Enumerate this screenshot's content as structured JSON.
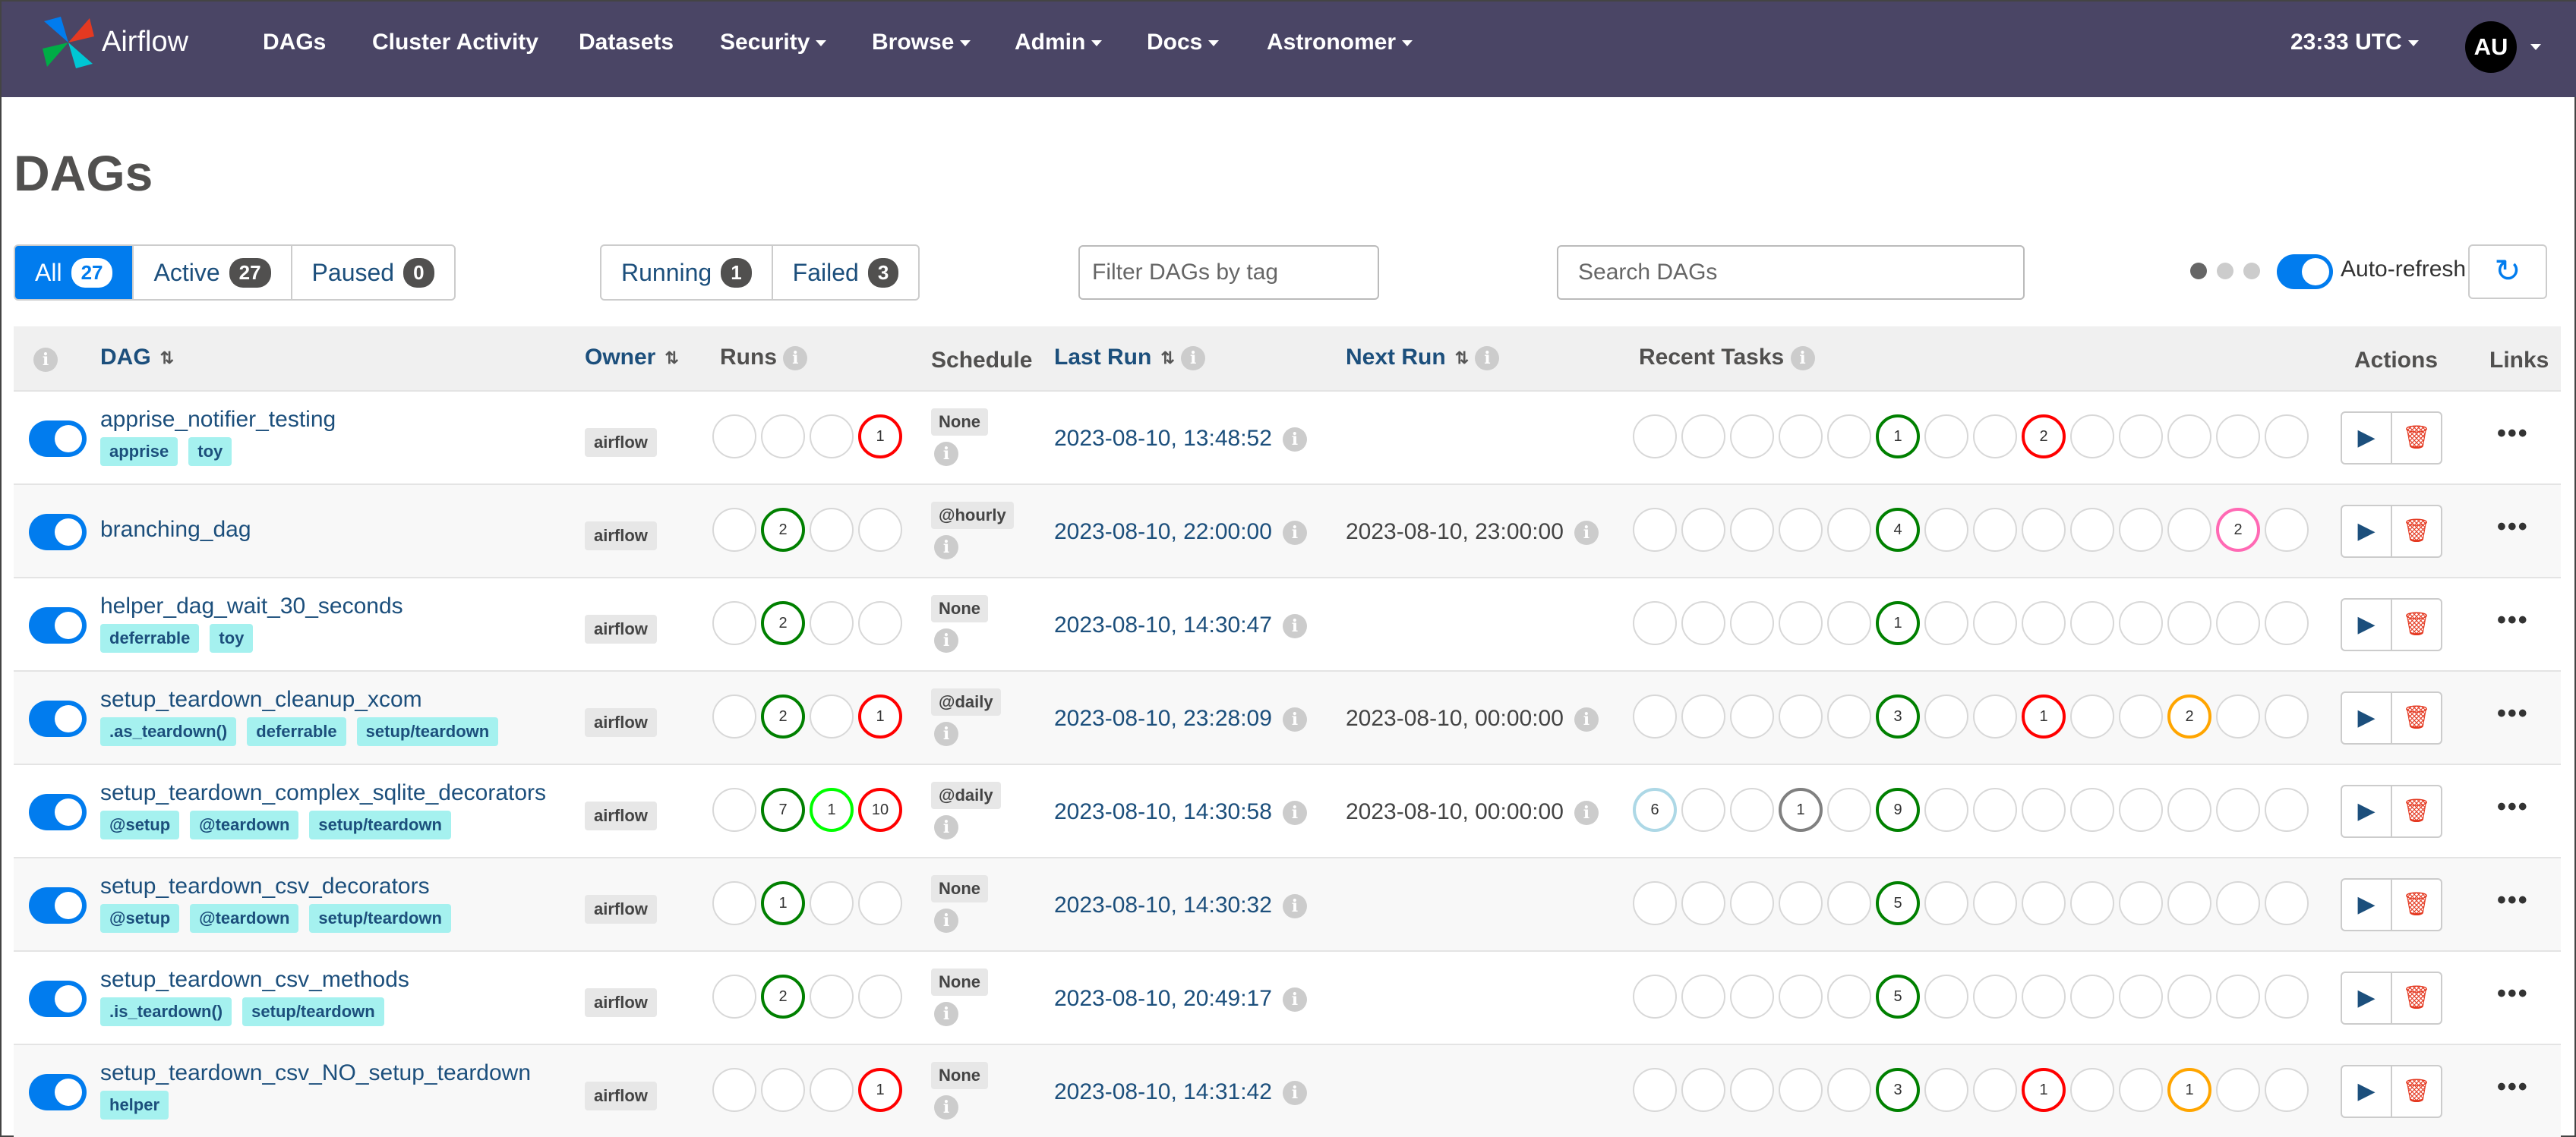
{
  "nav": {
    "brand": "Airflow",
    "links": [
      "DAGs",
      "Cluster Activity",
      "Datasets",
      "Security",
      "Browse",
      "Admin",
      "Docs",
      "Astronomer"
    ],
    "clock": "23:33 UTC",
    "avatar": "AU"
  },
  "page": {
    "title": "DAGs"
  },
  "filters": {
    "all": {
      "label": "All",
      "count": "27"
    },
    "active": {
      "label": "Active",
      "count": "27"
    },
    "paused": {
      "label": "Paused",
      "count": "0"
    },
    "running": {
      "label": "Running",
      "count": "1"
    },
    "failed": {
      "label": "Failed",
      "count": "3"
    },
    "tag_placeholder": "Filter DAGs by tag",
    "search_placeholder": "Search DAGs",
    "autorefresh_label": "Auto-refresh",
    "autorefresh_on": true
  },
  "table": {
    "headers": {
      "dag": "DAG",
      "owner": "Owner",
      "runs": "Runs",
      "schedule": "Schedule",
      "last_run": "Last Run",
      "next_run": "Next Run",
      "recent_tasks": "Recent Tasks",
      "actions": "Actions",
      "links": "Links"
    },
    "status_colors": {
      "success": "#008000",
      "failed": "#ff0000",
      "running": "#00ff00",
      "queued": "#808080",
      "upstream_failed": "#ffa500",
      "up_for_retry": "#ffd700",
      "skipped": "#ff69b4",
      "scheduled": "#add8e6"
    },
    "rows": [
      {
        "name": "apprise_notifier_testing",
        "tags": [
          "apprise",
          "toy"
        ],
        "owner": "airflow",
        "runs": [
          "",
          "",
          "",
          {
            "n": "1",
            "s": "failed"
          }
        ],
        "schedule": "None",
        "last_run": "2023-08-10, 13:48:52",
        "next_run": "",
        "recent": [
          "",
          "",
          "",
          "",
          "",
          {
            "n": "1",
            "s": "success"
          },
          "",
          "",
          {
            "n": "2",
            "s": "failed"
          },
          "",
          "",
          "",
          "",
          ""
        ]
      },
      {
        "name": "branching_dag",
        "tags": [],
        "owner": "airflow",
        "runs": [
          "",
          {
            "n": "2",
            "s": "success"
          },
          "",
          ""
        ],
        "schedule": "@hourly",
        "last_run": "2023-08-10, 22:00:00",
        "next_run": "2023-08-10, 23:00:00",
        "recent": [
          "",
          "",
          "",
          "",
          "",
          {
            "n": "4",
            "s": "success"
          },
          "",
          "",
          "",
          "",
          "",
          "",
          {
            "n": "2",
            "s": "skipped"
          },
          ""
        ]
      },
      {
        "name": "helper_dag_wait_30_seconds",
        "tags": [
          "deferrable",
          "toy"
        ],
        "owner": "airflow",
        "runs": [
          "",
          {
            "n": "2",
            "s": "success"
          },
          "",
          ""
        ],
        "schedule": "None",
        "last_run": "2023-08-10, 14:30:47",
        "next_run": "",
        "recent": [
          "",
          "",
          "",
          "",
          "",
          {
            "n": "1",
            "s": "success"
          },
          "",
          "",
          "",
          "",
          "",
          "",
          "",
          ""
        ]
      },
      {
        "name": "setup_teardown_cleanup_xcom",
        "tags": [
          ".as_teardown()",
          "deferrable",
          "setup/teardown"
        ],
        "owner": "airflow",
        "runs": [
          "",
          {
            "n": "2",
            "s": "success"
          },
          "",
          {
            "n": "1",
            "s": "failed"
          }
        ],
        "schedule": "@daily",
        "last_run": "2023-08-10, 23:28:09",
        "next_run": "2023-08-10, 00:00:00",
        "recent": [
          "",
          "",
          "",
          "",
          "",
          {
            "n": "3",
            "s": "success"
          },
          "",
          "",
          {
            "n": "1",
            "s": "failed"
          },
          "",
          "",
          {
            "n": "2",
            "s": "upstream_failed"
          },
          "",
          ""
        ]
      },
      {
        "name": "setup_teardown_complex_sqlite_decorators",
        "tags": [
          "@setup",
          "@teardown",
          "setup/teardown"
        ],
        "owner": "airflow",
        "runs": [
          "",
          {
            "n": "7",
            "s": "success"
          },
          {
            "n": "1",
            "s": "running"
          },
          {
            "n": "10",
            "s": "failed"
          }
        ],
        "schedule": "@daily",
        "last_run": "2023-08-10, 14:30:58",
        "next_run": "2023-08-10, 00:00:00",
        "recent": [
          {
            "n": "6",
            "s": "scheduled"
          },
          "",
          "",
          {
            "n": "1",
            "s": "queued"
          },
          "",
          {
            "n": "9",
            "s": "success"
          },
          "",
          "",
          "",
          "",
          "",
          "",
          "",
          ""
        ]
      },
      {
        "name": "setup_teardown_csv_decorators",
        "tags": [
          "@setup",
          "@teardown",
          "setup/teardown"
        ],
        "owner": "airflow",
        "runs": [
          "",
          {
            "n": "1",
            "s": "success"
          },
          "",
          ""
        ],
        "schedule": "None",
        "last_run": "2023-08-10, 14:30:32",
        "next_run": "",
        "recent": [
          "",
          "",
          "",
          "",
          "",
          {
            "n": "5",
            "s": "success"
          },
          "",
          "",
          "",
          "",
          "",
          "",
          "",
          ""
        ]
      },
      {
        "name": "setup_teardown_csv_methods",
        "tags": [
          ".is_teardown()",
          "setup/teardown"
        ],
        "owner": "airflow",
        "runs": [
          "",
          {
            "n": "2",
            "s": "success"
          },
          "",
          ""
        ],
        "schedule": "None",
        "last_run": "2023-08-10, 20:49:17",
        "next_run": "",
        "recent": [
          "",
          "",
          "",
          "",
          "",
          {
            "n": "5",
            "s": "success"
          },
          "",
          "",
          "",
          "",
          "",
          "",
          "",
          ""
        ]
      },
      {
        "name": "setup_teardown_csv_NO_setup_teardown",
        "tags": [
          "helper"
        ],
        "owner": "airflow",
        "runs": [
          "",
          "",
          "",
          {
            "n": "1",
            "s": "failed"
          }
        ],
        "schedule": "None",
        "last_run": "2023-08-10, 14:31:42",
        "next_run": "",
        "recent": [
          "",
          "",
          "",
          "",
          "",
          {
            "n": "3",
            "s": "success"
          },
          "",
          "",
          {
            "n": "1",
            "s": "failed"
          },
          "",
          "",
          {
            "n": "1",
            "s": "upstream_failed"
          },
          "",
          ""
        ]
      }
    ]
  }
}
